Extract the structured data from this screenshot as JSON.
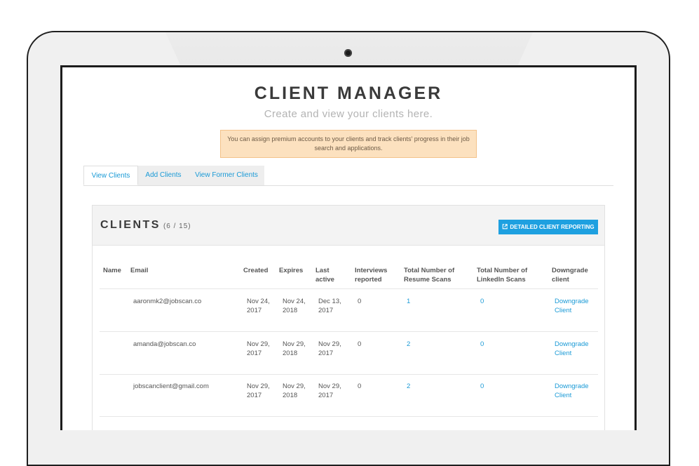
{
  "page": {
    "title": "CLIENT MANAGER",
    "subtitle": "Create and view your clients here.",
    "notice": "You can assign premium accounts to your clients and track clients' progress in their job search and applications."
  },
  "tabs": [
    {
      "label": "View Clients",
      "active": true
    },
    {
      "label": "Add Clients",
      "active": false
    },
    {
      "label": "View Former Clients",
      "active": false
    }
  ],
  "clients_panel": {
    "title": "CLIENTS",
    "count": "(6 / 15)",
    "report_button": "DETAILED CLIENT REPORTING"
  },
  "table": {
    "headers": {
      "name": "Name",
      "email": "Email",
      "created": "Created",
      "expires": "Expires",
      "last_active": "Last active",
      "interviews": "Interviews reported",
      "resume_scans": "Total Number of Resume Scans",
      "linkedin_scans": "Total Number of LinkedIn Scans",
      "downgrade": "Downgrade client"
    },
    "rows": [
      {
        "name": "",
        "email": "aaronmk2@jobscan.co",
        "created": "Nov 24, 2017",
        "expires": "Nov 24, 2018",
        "last_active": "Dec 13, 2017",
        "interviews": "0",
        "resume_scans": "1",
        "linkedin_scans": "0",
        "downgrade": "Downgrade Client"
      },
      {
        "name": "",
        "email": "amanda@jobscan.co",
        "created": "Nov 29, 2017",
        "expires": "Nov 29, 2018",
        "last_active": "Nov 29, 2017",
        "interviews": "0",
        "resume_scans": "2",
        "linkedin_scans": "0",
        "downgrade": "Downgrade Client"
      },
      {
        "name": "",
        "email": "jobscanclient@gmail.com",
        "created": "Nov 29, 2017",
        "expires": "Nov 29, 2018",
        "last_active": "Nov 29, 2017",
        "interviews": "0",
        "resume_scans": "2",
        "linkedin_scans": "0",
        "downgrade": "Downgrade Client"
      }
    ]
  },
  "colors": {
    "accent": "#1a9ad6",
    "button": "#1ea0e0",
    "notice_bg": "#fce1bf",
    "notice_border": "#f3c28a"
  },
  "icons": {
    "report_button": "external-link-icon",
    "camera": "camera-icon"
  }
}
